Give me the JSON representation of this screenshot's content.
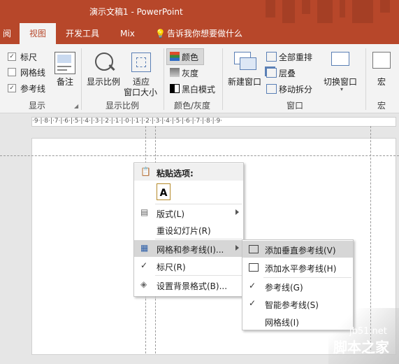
{
  "title": "演示文稿1  -  PowerPoint",
  "tabs": [
    "阅",
    "视图",
    "开发工具",
    "Mix",
    "告诉我你想要做什么"
  ],
  "show": {
    "ruler": "标尺",
    "gridlines": "网格线",
    "guides": "参考线",
    "notes": "备注",
    "group": "显示"
  },
  "zoom": {
    "zoom": "显示比例",
    "fit1": "适应",
    "fit2": "窗口大小",
    "group": "显示比例"
  },
  "color": {
    "color": "颜色",
    "gray": "灰度",
    "bw": "黑白模式",
    "group": "颜色/灰度"
  },
  "window": {
    "new1": "新建窗口",
    "arrange": "全部重排",
    "cascade": "层叠",
    "split": "移动拆分",
    "switch": "切换窗口",
    "group": "窗口"
  },
  "macro": {
    "label": "宏",
    "group": "宏"
  },
  "ruler_text": "·9·|·8·|·7·|·6·|·5·|·4·|·3·|·2·|·1·|·0·|·1·|·2·|·3·|·4·|·5·|·6·|·7·|·8·|·9·",
  "menu": {
    "paste_header": "粘贴选项:",
    "layout": "版式(L)",
    "reset": "重设幻灯片(R)",
    "grid_guides": "网格和参考线(I)...",
    "ruler": "标尺(R)",
    "bg": "设置背景格式(B)..."
  },
  "submenu": {
    "add_v": "添加垂直参考线(V)",
    "add_h": "添加水平参考线(H)",
    "guides": "参考线(G)",
    "smart": "智能参考线(S)",
    "grid": "网格线(I)"
  },
  "watermark": {
    "site": "jb51.net",
    "name": "脚本之家"
  }
}
